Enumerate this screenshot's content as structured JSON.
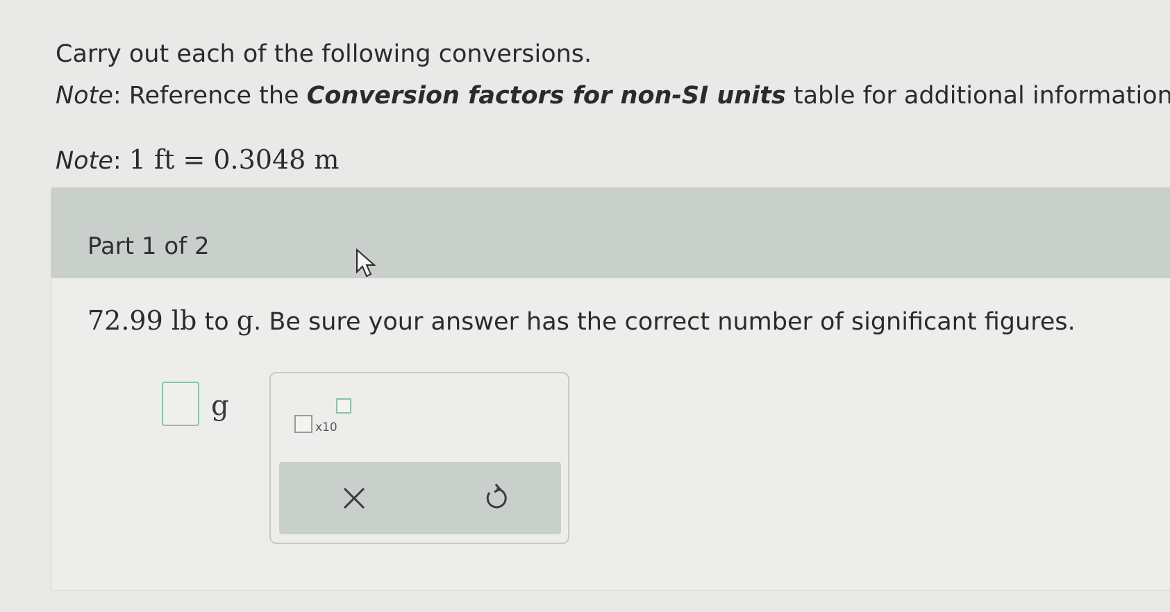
{
  "intro": "Carry out each of the following conversions.",
  "note1": {
    "label": "Note",
    "before": ": Reference the ",
    "bold": "Conversion factors for non-SI units",
    "after": " table for additional information."
  },
  "note2": {
    "label": "Note",
    "colon": ": ",
    "math": "1 ft = 0.3048 m"
  },
  "part": {
    "title": "Part 1 of 2"
  },
  "question": {
    "quantity": "72.99 lb",
    "to": " to ",
    "target": "g",
    "instruction": ". Be sure your answer has the correct number of significant figures."
  },
  "answer": {
    "value": "",
    "unit": "g"
  },
  "palette": {
    "sci_label": "x10",
    "clear_icon": "close-icon",
    "undo_icon": "undo-icon"
  },
  "colors": {
    "header_bg": "#c9cfca",
    "input_border": "#8fbea7",
    "page_bg": "#e9e9e7"
  }
}
